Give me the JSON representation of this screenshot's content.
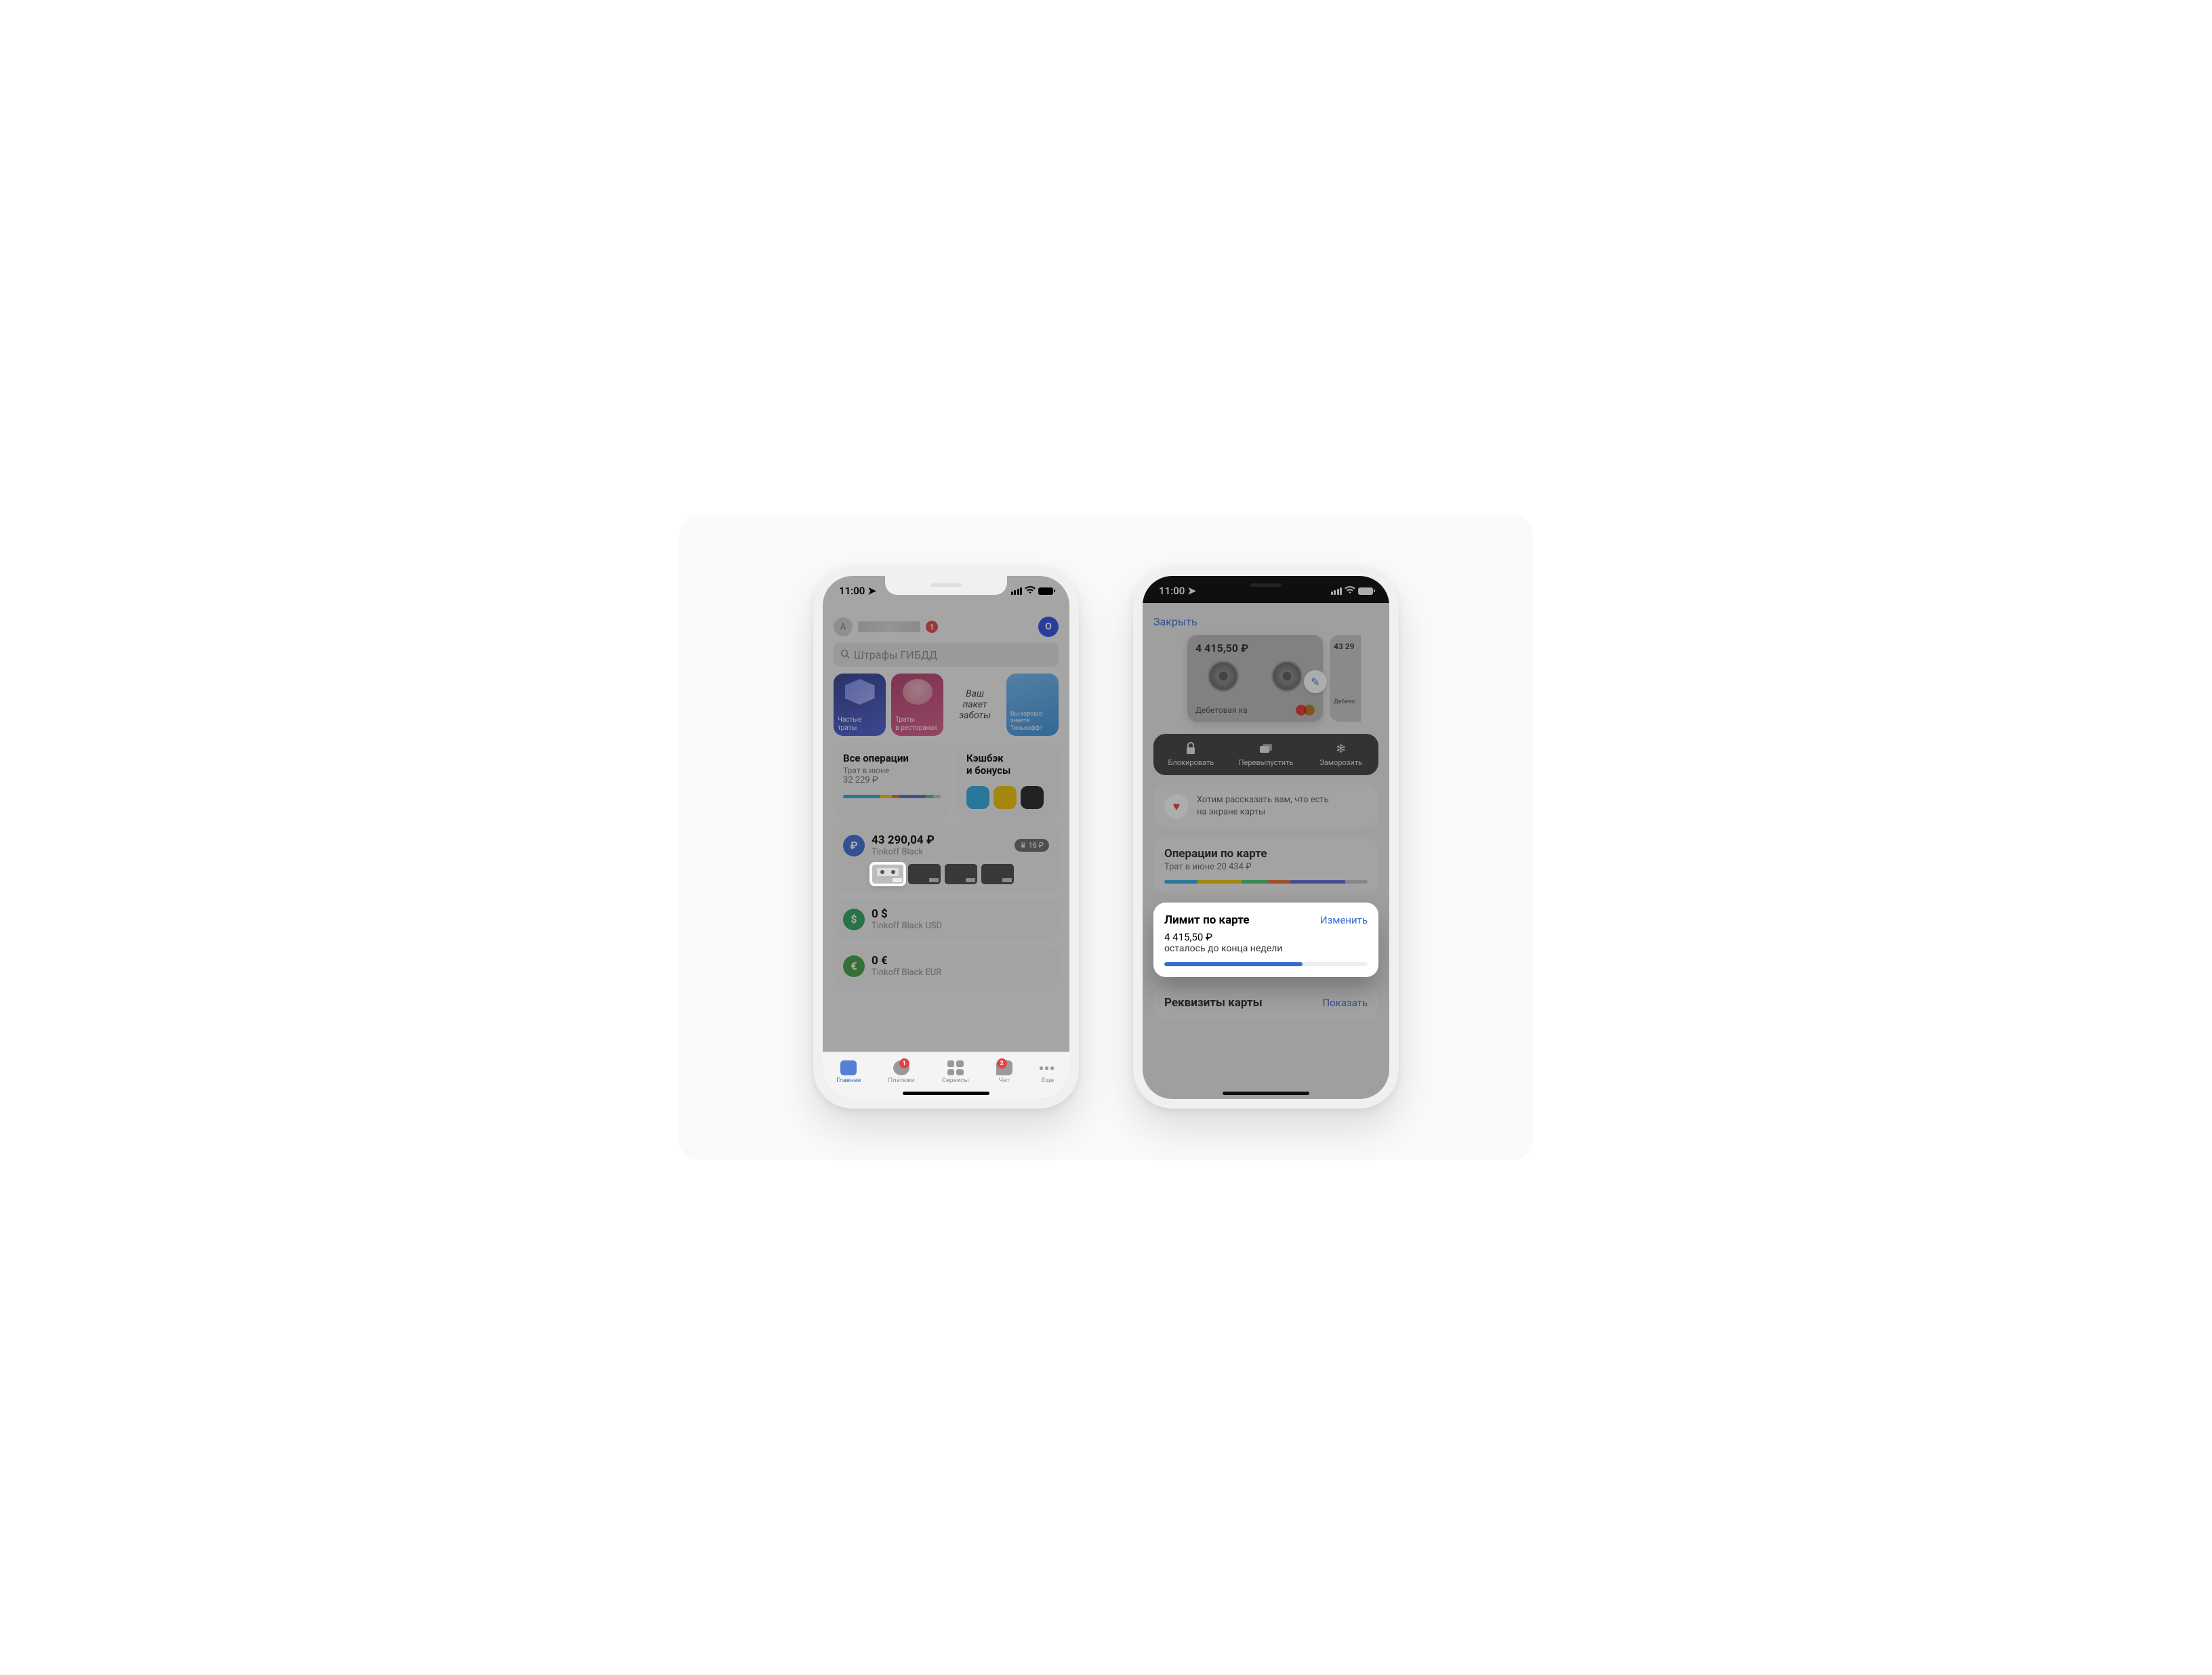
{
  "status": {
    "time": "11:00"
  },
  "phone1": {
    "header": {
      "avatar_letter": "A",
      "notif_count": "1",
      "o_badge": "O"
    },
    "search": {
      "placeholder": "Штрафы ГИБДД"
    },
    "stories": [
      {
        "label": "Частые траты"
      },
      {
        "label": "Траты\nв ресторанах"
      },
      {
        "label": "Ваш\nпакет\nзаботы"
      },
      {
        "label": "Вы хорошо\nзнаете\nТинькофф?"
      }
    ],
    "operations": {
      "title": "Все операции",
      "sub": "Трат в июне",
      "amount": "32 229 ₽"
    },
    "cashback": {
      "title": "Кэшбэк\nи бонусы"
    },
    "accounts": [
      {
        "balance": "43 290,04 ₽",
        "name": "Tinkoff Black",
        "crown": "16 ₽",
        "has_minis": true
      },
      {
        "balance": "0 $",
        "name": "Tinkoff Black USD"
      },
      {
        "balance": "0 €",
        "name": "Tinkoff Black EUR"
      }
    ],
    "tabs": [
      {
        "label": "Главная"
      },
      {
        "label": "Платежи",
        "badge": "1"
      },
      {
        "label": "Сервисы"
      },
      {
        "label": "Чат",
        "badge": "2"
      },
      {
        "label": "Еще"
      }
    ]
  },
  "phone2": {
    "close": "Закрыть",
    "card": {
      "balance": "4 415,50 ₽",
      "label": "Дебетовая ка"
    },
    "peek": {
      "balance": "43 29",
      "label": "Дебето"
    },
    "actions": [
      {
        "label": "Блокировать"
      },
      {
        "label": "Перевыпустить"
      },
      {
        "label": "Заморозить"
      }
    ],
    "info": {
      "line1": "Хотим рассказать вам, что есть",
      "line2": "на экране карты"
    },
    "ops": {
      "title": "Операции по карте",
      "sub": "Трат в июне 20 434 ₽"
    },
    "limit": {
      "title": "Лимит по карте",
      "change": "Изменить",
      "amount": "4 415,50 ₽",
      "remaining": "осталось до конца недели"
    },
    "requisites": {
      "title": "Реквизиты карты",
      "show": "Показать"
    }
  }
}
